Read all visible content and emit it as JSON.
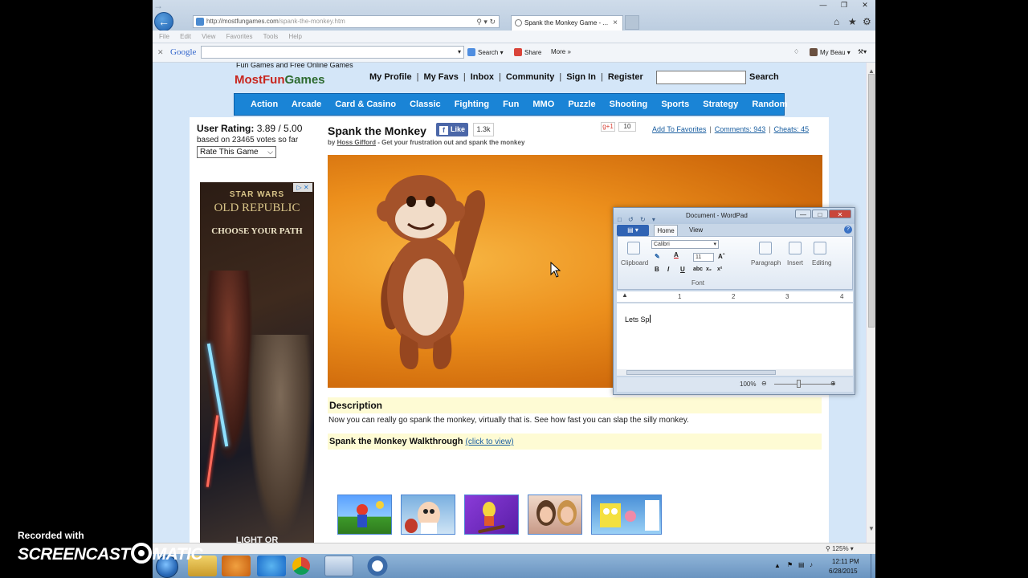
{
  "browser": {
    "url_host": "http://mostfungames.com",
    "url_path": "/spank-the-monkey.htm",
    "tab_title": "Spank the Monkey Game - ...",
    "menu": [
      "File",
      "Edit",
      "View",
      "Favorites",
      "Tools",
      "Help"
    ],
    "google_label": "Google",
    "toolbar_search": "Search",
    "toolbar_share": "Share",
    "toolbar_more": "More »",
    "toolbar_user": "My Beau",
    "zoom": "125%"
  },
  "site": {
    "tagline": "Fun Games and Free Online Games",
    "logo_part1": "MostFun",
    "logo_part2": "Games",
    "top_links": [
      "My Profile",
      "My Favs",
      "Inbox",
      "Community",
      "Sign In",
      "Register"
    ],
    "search_button": "Search",
    "categories": [
      "Action",
      "Arcade",
      "Card & Casino",
      "Classic",
      "Fighting",
      "Fun",
      "MMO",
      "Puzzle",
      "Shooting",
      "Sports",
      "Strategy",
      "Random"
    ]
  },
  "rating": {
    "label": "User Rating:",
    "value": "3.89 / 5.00",
    "votes_text": "based on 23465 votes so far",
    "select_value": "Rate This Game"
  },
  "ad": {
    "line1": "STAR WARS",
    "line2": "OLD REPUBLIC",
    "line3": "CHOOSE YOUR PATH",
    "line4": "LIGHT OR"
  },
  "game": {
    "title": "Spank the Monkey",
    "fb_like": "Like",
    "fb_count": "1.3k",
    "by_prefix": "by",
    "author": "Hoss Gifford",
    "by_suffix": "- Get your frustration out and spank the monkey",
    "gplus": "g+1",
    "gplus_count": "10",
    "add_fav": "Add To Favorites",
    "comments": "Comments: 943",
    "cheats": "Cheats: 45",
    "description_heading": "Description",
    "description_text": "Now you can really go spank the monkey, virtually that is. See how fast you can slap the silly monkey.",
    "walkthrough_heading": "Spank the Monkey Walkthrough",
    "walkthrough_link": "(click to view)"
  },
  "wordpad": {
    "title": "Document - WordPad",
    "tab_home": "Home",
    "tab_view": "View",
    "group_clipboard": "Clipboard",
    "group_font": "Font",
    "group_paragraph": "Paragraph",
    "group_insert": "Insert",
    "group_editing": "Editing",
    "font_name": "Calibri",
    "font_size": "11",
    "ruler_marks": [
      "1",
      "2",
      "3",
      "4"
    ],
    "doc_text": "Lets Sp",
    "zoom": "100%"
  },
  "taskbar": {
    "time": "12:11 PM",
    "date": "6/28/2015"
  },
  "watermark": {
    "recorded": "Recorded with",
    "brand_left": "SCREENCAST",
    "brand_right": "MATIC"
  },
  "colors": {
    "category_bar": "#1a84d6",
    "logo_red": "#c8261e",
    "logo_green": "#2d6a2f",
    "link_blue": "#1a5ea0",
    "highlight_bar": "#fefbd4"
  }
}
